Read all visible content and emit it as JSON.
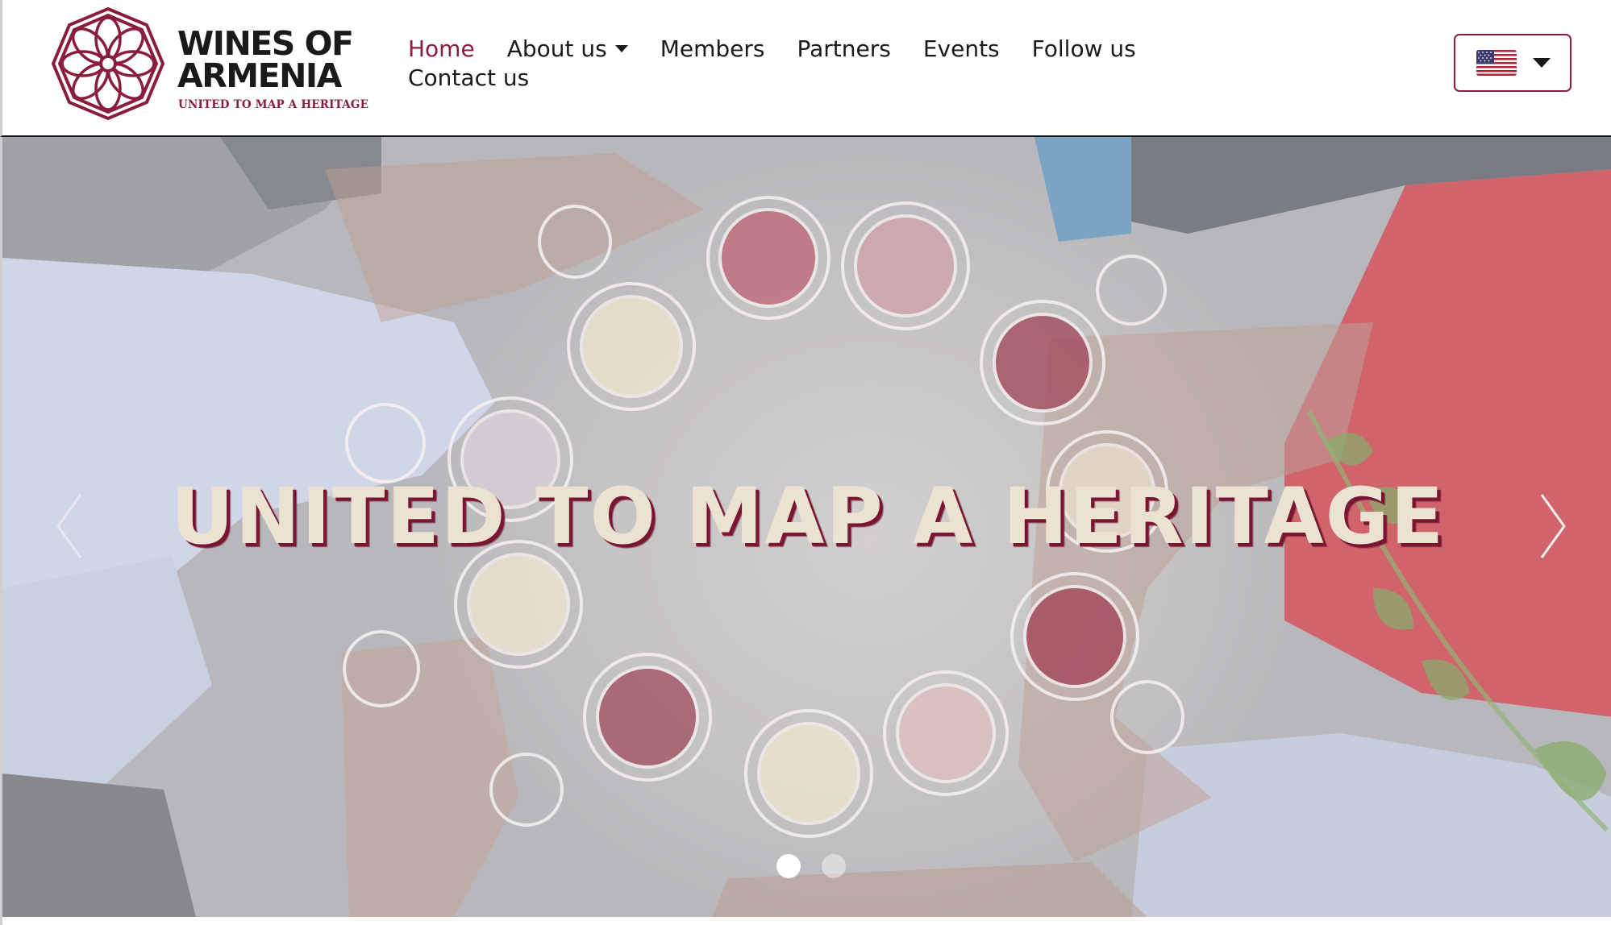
{
  "header": {
    "logo": {
      "title_line1": "WINES OF",
      "title_line2": "ARMENIA",
      "tagline": "UNITED TO MAP A HERITAGE",
      "icon": "wines-of-armenia-emblem"
    },
    "nav": {
      "row1": [
        {
          "label": "Home",
          "active": true
        },
        {
          "label": "About us",
          "has_dropdown": true
        },
        {
          "label": "Members"
        },
        {
          "label": "Partners"
        },
        {
          "label": "Events"
        },
        {
          "label": "Follow us"
        }
      ],
      "row2": [
        {
          "label": "Contact us"
        }
      ]
    },
    "language_selector": {
      "flag": "us-flag-icon",
      "caret": "caret-down-icon"
    }
  },
  "hero": {
    "headline": "UNITED TO MAP A HERITAGE",
    "prev_icon": "chevron-left-icon",
    "next_icon": "chevron-right-icon",
    "slides_total": 2,
    "active_slide": 1
  },
  "colors": {
    "brand": "#8a1d3c",
    "text": "#1a1a1a",
    "headline": "#ece2d2",
    "headline_shadow": "#7a1632"
  }
}
